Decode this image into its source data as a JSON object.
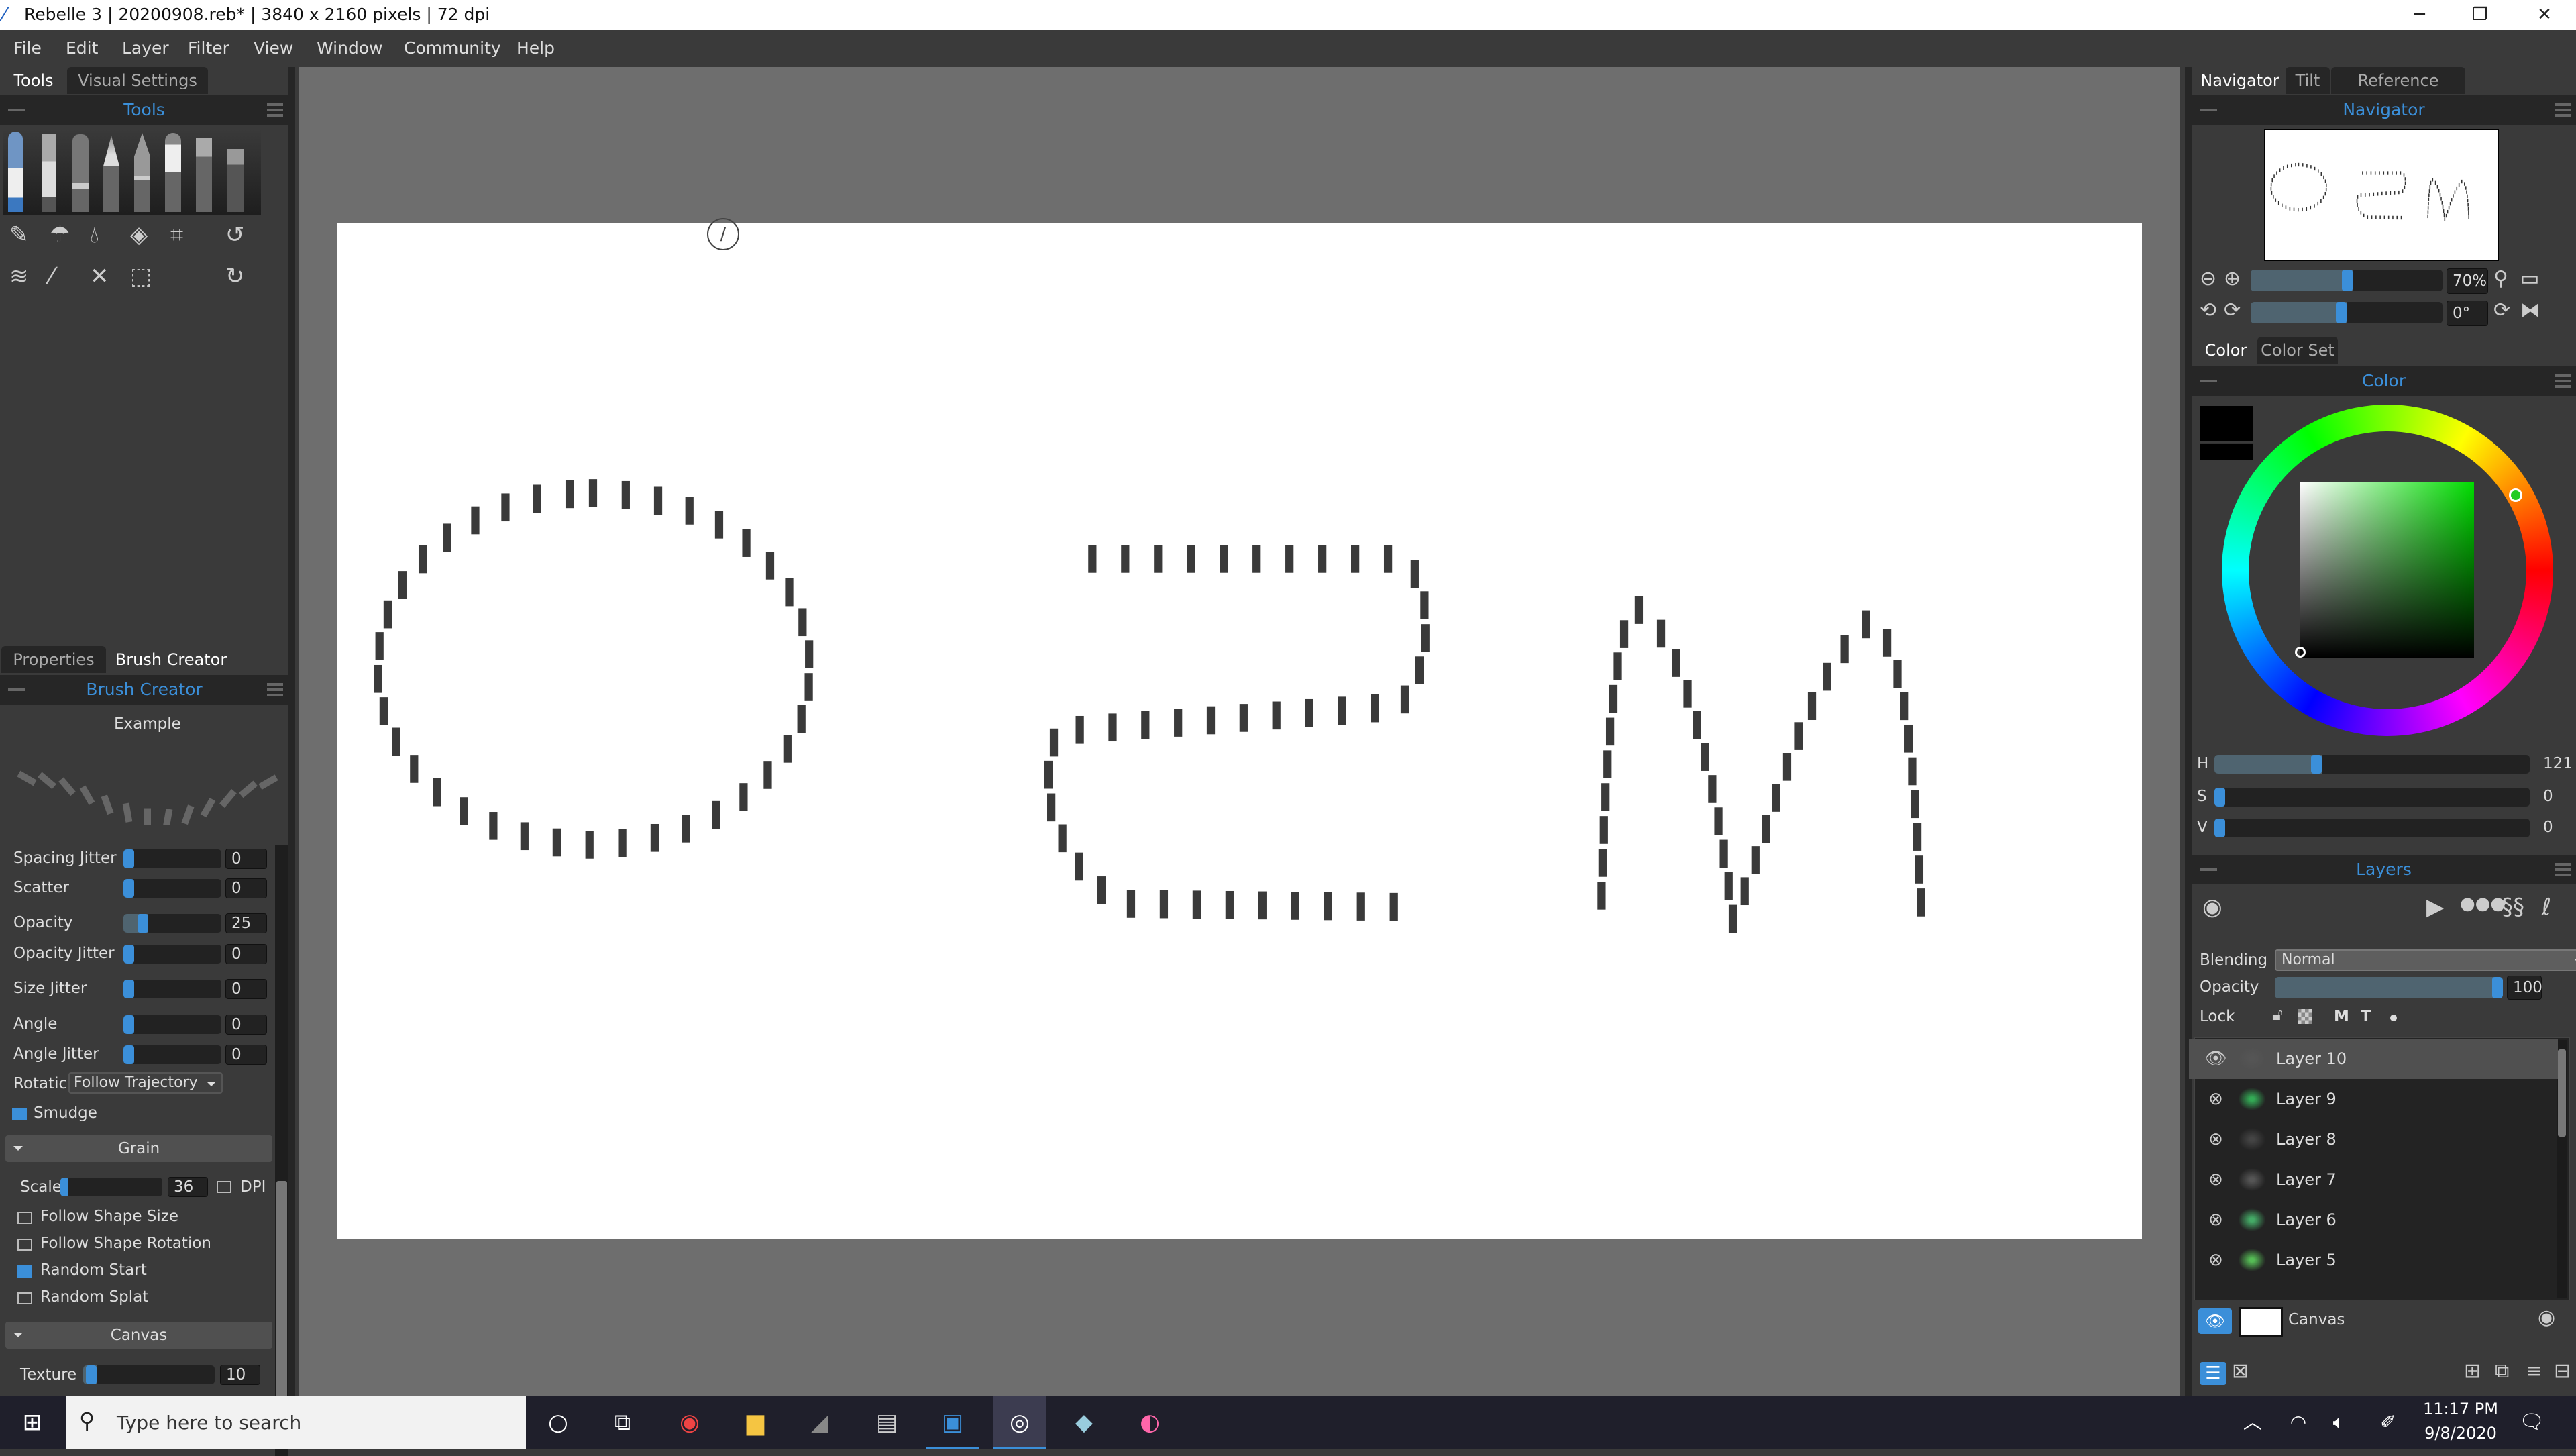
{
  "window": {
    "title": "Rebelle 3 | 20200908.reb* | 3840 x 2160 pixels | 72 dpi",
    "minimize": "─",
    "maximize": "❐",
    "close": "✕"
  },
  "menu": [
    "File",
    "Edit",
    "Layer",
    "Filter",
    "View",
    "Window",
    "Community",
    "Help"
  ],
  "left_tabs": [
    "Tools",
    "Visual Settings"
  ],
  "tools_panel": {
    "title": "Tools"
  },
  "props_tabs": [
    "Properties",
    "Brush Creator"
  ],
  "brush_creator": {
    "title": "Brush Creator",
    "example_label": "Example",
    "sliders": [
      {
        "label": "Spacing Jitter",
        "value": "0",
        "fraction": 0
      },
      {
        "label": "Scatter",
        "value": "0",
        "fraction": 0
      },
      {
        "label": "Opacity",
        "value": "25",
        "fraction": 0.25
      },
      {
        "label": "Opacity Jitter",
        "value": "0",
        "fraction": 0
      },
      {
        "label": "Size Jitter",
        "value": "0",
        "fraction": 0
      },
      {
        "label": "Angle",
        "value": "0",
        "fraction": 0
      },
      {
        "label": "Angle Jitter",
        "value": "0",
        "fraction": 0
      }
    ],
    "rotation_label": "Rotatic",
    "rotation_value": "Follow Trajectory",
    "smudge": {
      "label": "Smudge",
      "checked": true
    },
    "grain": {
      "title": "Grain",
      "scale_label": "Scale",
      "scale_value": "36",
      "scale_fraction": 0.08,
      "dpi_label": "DPI",
      "dpi_checked": false,
      "options": [
        {
          "label": "Follow Shape Size",
          "checked": false
        },
        {
          "label": "Follow Shape Rotation",
          "checked": false
        },
        {
          "label": "Random Start",
          "checked": true
        },
        {
          "label": "Random Splat",
          "checked": false
        }
      ]
    },
    "canvas": {
      "title": "Canvas",
      "texture_label": "Texture",
      "texture_value": "10",
      "texture_fraction": 0.1
    }
  },
  "right_tabs": [
    "Navigator",
    "Tilt",
    "Reference Image"
  ],
  "navigator": {
    "title": "Navigator",
    "zoom": "70%",
    "zoom_fraction": 0.53,
    "rotation": "0°",
    "rotation_fraction": 0.5
  },
  "color_tabs": [
    "Color",
    "Color Set"
  ],
  "color": {
    "title": "Color",
    "primary": "#000000",
    "secondary": "#000000",
    "hue_deg": 121,
    "h": {
      "label": "H",
      "value": "121",
      "fraction": 0.34
    },
    "s": {
      "label": "S",
      "value": "0",
      "fraction": 0
    },
    "v": {
      "label": "V",
      "value": "0",
      "fraction": 0
    }
  },
  "layers": {
    "title": "Layers",
    "blending_label": "Blending",
    "blending_value": "Normal",
    "opacity_label": "Opacity",
    "opacity_value": "100",
    "opacity_fraction": 1.0,
    "lock_label": "Lock",
    "lock_icons": [
      "M",
      "T"
    ],
    "items": [
      {
        "name": "Layer 10",
        "visible": true,
        "selected": true
      },
      {
        "name": "Layer 9",
        "visible": false
      },
      {
        "name": "Layer 8",
        "visible": false
      },
      {
        "name": "Layer 7",
        "visible": false
      },
      {
        "name": "Layer 6",
        "visible": false
      },
      {
        "name": "Layer 5",
        "visible": false
      }
    ],
    "canvas_label": "Canvas"
  },
  "taskbar": {
    "search_placeholder": "Type here to search",
    "time": "11:17 PM",
    "date": "9/8/2020"
  },
  "accent": "#3b8fd9"
}
